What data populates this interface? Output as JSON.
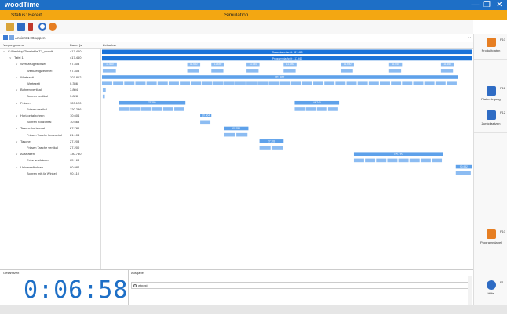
{
  "app": {
    "title": "woodTime",
    "status": "Status: Bereit",
    "mode": "Simulation",
    "window_controls": [
      "minimize-icon",
      "restore-icon",
      "close-icon"
    ]
  },
  "toolbar": {
    "icons": [
      "open-folder-icon",
      "save-icon",
      "book-icon",
      "settings-icon",
      "record-icon"
    ]
  },
  "view_selector": {
    "label": "Ansicht 1: Gruppen",
    "chevron": "chevron-down-icon"
  },
  "table": {
    "col_name": "Vorgangsname",
    "col_duration": "Dauer [s]",
    "col_chart": "Zeitachse"
  },
  "tree_rows": [
    {
      "name": "C:\\Desktop\\Timetable\\T1_woodt...",
      "duration": "417.460",
      "indent": 0,
      "kind": "root"
    },
    {
      "name": "Tafel 1",
      "duration": "417.460",
      "indent": 1,
      "kind": "group"
    },
    {
      "name": "Werkzeugwechsel",
      "duration": "97.408",
      "indent": 2,
      "kind": "group"
    },
    {
      "name": "Werkzeugwechsel",
      "duration": "97.408",
      "indent": 3,
      "kind": "leaf"
    },
    {
      "name": "Wartezeit",
      "duration": "207.812",
      "indent": 2,
      "kind": "group"
    },
    {
      "name": "Wartezeit",
      "duration": "0.356",
      "indent": 3,
      "kind": "leaf"
    },
    {
      "name": "Bohren vertikal",
      "duration": "3.804",
      "indent": 2,
      "kind": "group"
    },
    {
      "name": "Bohren vertikal",
      "duration": "3.828",
      "indent": 3,
      "kind": "leaf"
    },
    {
      "name": "Fräsen",
      "duration": "120.120",
      "indent": 2,
      "kind": "group"
    },
    {
      "name": "Fräsen vertikal",
      "duration": "120.236",
      "indent": 3,
      "kind": "leaf"
    },
    {
      "name": "Horizontalbohren",
      "duration": "10.604",
      "indent": 2,
      "kind": "group"
    },
    {
      "name": "Bohren horizontal",
      "duration": "10.668",
      "indent": 3,
      "kind": "leaf"
    },
    {
      "name": "Tasche horizontal",
      "duration": "27.780",
      "indent": 2,
      "kind": "group"
    },
    {
      "name": "Fräsen Tasche horizontal",
      "duration": "21.104",
      "indent": 3,
      "kind": "leaf"
    },
    {
      "name": "Tasche",
      "duration": "27.208",
      "indent": 2,
      "kind": "group"
    },
    {
      "name": "Fräsen Tasche vertikal",
      "duration": "27.200",
      "indent": 3,
      "kind": "leaf"
    },
    {
      "name": "Ausfräsen",
      "duration": "130.780",
      "indent": 2,
      "kind": "group"
    },
    {
      "name": "Ecke ausfräsen",
      "duration": "95.168",
      "indent": 3,
      "kind": "leaf"
    },
    {
      "name": "Universalbohren",
      "duration": "90.982",
      "indent": 2,
      "kind": "group"
    },
    {
      "name": "Bohren mit 4x Winkel",
      "duration": "90.110",
      "indent": 3,
      "kind": "leaf"
    }
  ],
  "gantt_bars": [
    {
      "row": 0,
      "start": 0.0,
      "end": 1.0,
      "label": "Gesamtarbeitszeit: 417.460",
      "style": "main"
    },
    {
      "row": 1,
      "start": 0.0,
      "end": 1.0,
      "label": "Programmlaufzeit: 417.460",
      "style": "main"
    },
    {
      "row": 2,
      "start": 0.002,
      "end": 0.04,
      "label": "11.640",
      "style": "seg"
    },
    {
      "row": 2,
      "start": 0.23,
      "end": 0.265,
      "label": "11.640",
      "style": "seg"
    },
    {
      "row": 2,
      "start": 0.295,
      "end": 0.33,
      "label": "11.640",
      "style": "seg"
    },
    {
      "row": 2,
      "start": 0.39,
      "end": 0.425,
      "label": "11.640",
      "style": "seg"
    },
    {
      "row": 2,
      "start": 0.49,
      "end": 0.525,
      "label": "11.640",
      "style": "seg"
    },
    {
      "row": 2,
      "start": 0.645,
      "end": 0.68,
      "label": "11.640",
      "style": "seg"
    },
    {
      "row": 2,
      "start": 0.775,
      "end": 0.81,
      "label": "11.640",
      "style": "seg"
    },
    {
      "row": 2,
      "start": 0.915,
      "end": 0.95,
      "label": "11.640",
      "style": "seg"
    },
    {
      "row": 4,
      "start": 0.0,
      "end": 0.96,
      "label": "207.812",
      "style": "group"
    },
    {
      "row": 6,
      "start": 0.002,
      "end": 0.01,
      "label": "",
      "style": "seg"
    },
    {
      "row": 8,
      "start": 0.045,
      "end": 0.225,
      "label": "75.380",
      "style": "group"
    },
    {
      "row": 8,
      "start": 0.52,
      "end": 0.64,
      "label": "44.740",
      "style": "group"
    },
    {
      "row": 10,
      "start": 0.265,
      "end": 0.295,
      "label": "10.604",
      "style": "group"
    },
    {
      "row": 12,
      "start": 0.33,
      "end": 0.395,
      "label": "27.780",
      "style": "group"
    },
    {
      "row": 14,
      "start": 0.425,
      "end": 0.49,
      "label": "27.208",
      "style": "group"
    },
    {
      "row": 16,
      "start": 0.68,
      "end": 0.92,
      "label": "100.780",
      "style": "group"
    },
    {
      "row": 18,
      "start": 0.955,
      "end": 0.998,
      "label": "90.982",
      "style": "group"
    }
  ],
  "bottom": {
    "left_label": "Gesamtzeit",
    "clock": "0:06:58",
    "right_label": "Ausgabe",
    "output_text": "wtpost",
    "output_icon": "log-icon"
  },
  "side_panel": {
    "buttons": [
      {
        "icon": "product-icon",
        "fkey": "F10",
        "label": "Produktdaten"
      },
      {
        "icon": "workpiece-icon",
        "fkey": "F11",
        "label": "Plattenlegung"
      },
      {
        "icon": "reset-icon",
        "fkey": "F12",
        "label": "Zurücksetzen"
      },
      {
        "icon": "program-icon",
        "fkey": "F10",
        "label": "Programmlabel"
      },
      {
        "icon": "help-icon",
        "fkey": "F1",
        "label": "Hilfe"
      }
    ]
  },
  "colors": {
    "titlebar": "#1e6fc6",
    "statusbar": "#f3a712",
    "bar_main": "#1a73d9",
    "bar_group": "#5ea1ea",
    "bar_seg": "#8cbcf2",
    "clock": "#1e6fc6"
  }
}
